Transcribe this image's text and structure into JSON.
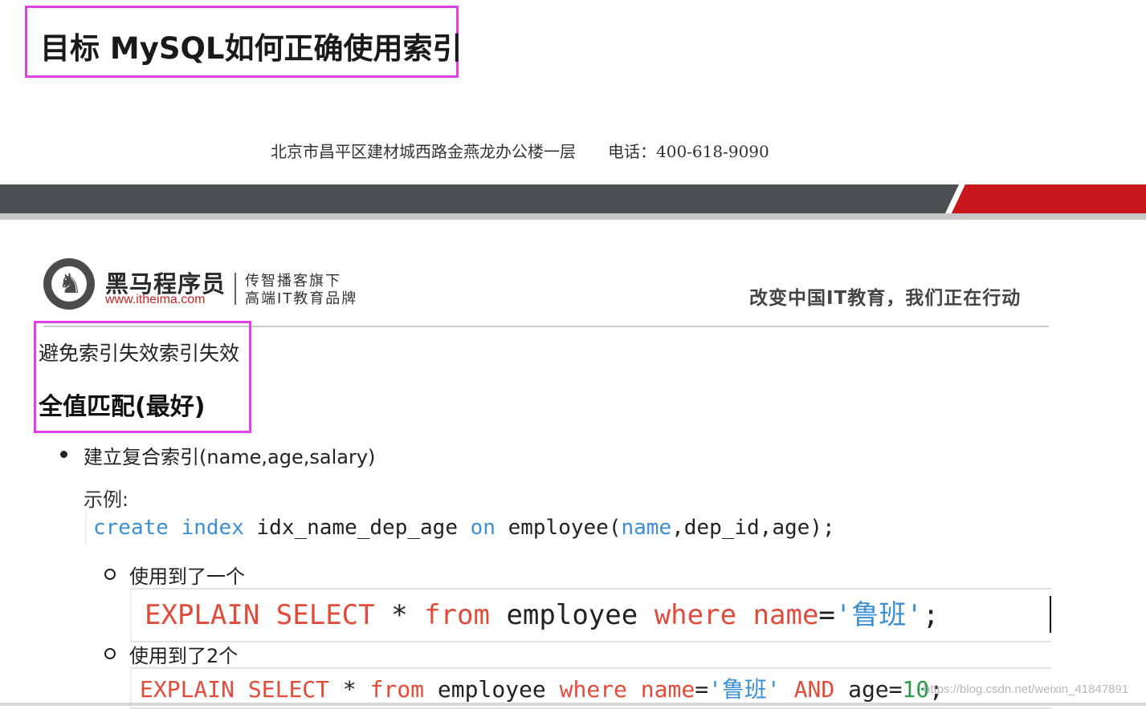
{
  "header": {
    "title": "目标 MySQL如何正确使用索引"
  },
  "slide": {
    "address": "北京市昌平区建材城西路金燕龙办公楼一层",
    "phone": "电话：400-618-9090",
    "colors": {
      "band_gray": "#4a5052",
      "band_red": "#c8161d",
      "highlight_box": "#e43fe6"
    }
  },
  "brand": {
    "logo_icon": "horse-head-logo-icon",
    "name": "黑马程序员",
    "url": "www.itheima.com",
    "tagline1": "传智播客旗下",
    "tagline2": "高端IT教育品牌",
    "slogan": "改变中国IT教育，我们正在行动"
  },
  "content": {
    "subtitle": "避免索引失效索引失效",
    "heading": "全值匹配(最好)",
    "bullet": "建立复合索引(name,age,salary)",
    "example_label": "示例:",
    "code1": {
      "kw1": "create",
      "kw2": "index",
      "ident": "idx_name_dep_age",
      "kw3": "on",
      "table": "employee(",
      "col1": "name",
      "rest": ",dep_id,age);"
    },
    "sub_items": [
      {
        "label": "使用到了一个"
      },
      {
        "label": "使用到了2个"
      }
    ],
    "code2": {
      "kw_explain": "EXPLAIN",
      "kw_select": "SELECT",
      "star": "*",
      "kw_from": "from",
      "table": "employee",
      "kw_where": "where",
      "col": "name",
      "eq": "=",
      "value": "'鲁班'",
      "end": ";"
    },
    "code3": {
      "kw_explain": "EXPLAIN",
      "kw_select": "SELECT",
      "star": "*",
      "kw_from": "from",
      "table": "employee",
      "kw_where": "where",
      "col": "name",
      "eq": "=",
      "value": "'鲁班'",
      "kw_and": "AND",
      "col2": "age",
      "eq2": "=",
      "num": "10",
      "end": ";"
    }
  },
  "watermark": "https://blog.csdn.net/weixin_41847891"
}
